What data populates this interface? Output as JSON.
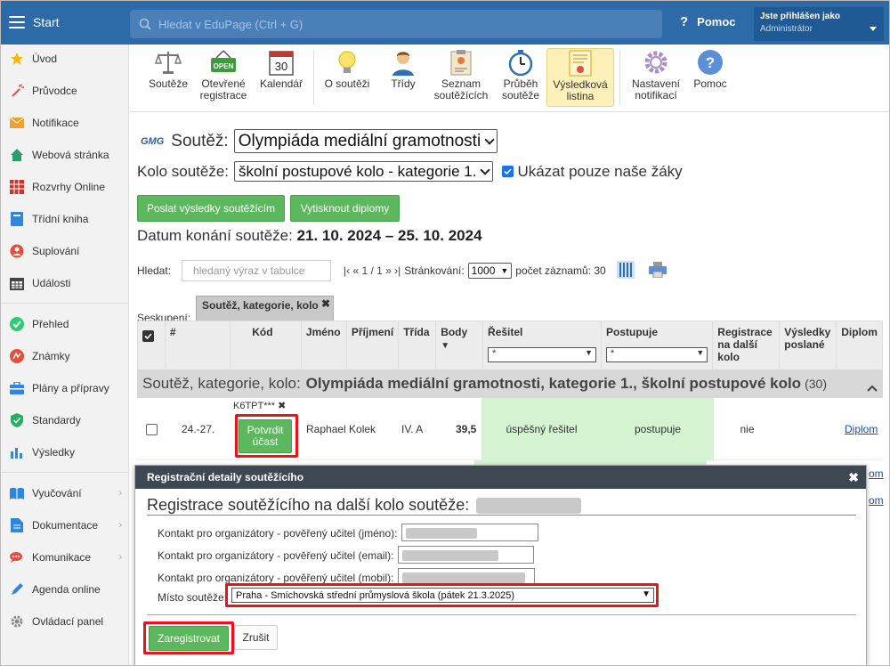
{
  "topbar": {
    "start_label": "Start",
    "search_placeholder": "Hledat v EduPage (Ctrl + G)",
    "help_label": "Pomoc",
    "user_line1": "Jste přihlášen jako",
    "user_line2": "Administrátor"
  },
  "sidebar": {
    "items": [
      {
        "label": "Úvod",
        "icon": "star-icon"
      },
      {
        "label": "Průvodce",
        "icon": "wand-icon"
      },
      {
        "label": "Notifikace",
        "icon": "envelope-icon"
      },
      {
        "label": "Webová stránka",
        "icon": "house-icon"
      },
      {
        "label": "Rozvrhy Online",
        "icon": "grid-icon"
      },
      {
        "label": "Třídní kniha",
        "icon": "book-icon"
      },
      {
        "label": "Suplování",
        "icon": "person-icon"
      },
      {
        "label": "Události",
        "icon": "calendar-icon"
      },
      {
        "label": "Přehled",
        "icon": "check-circle-icon"
      },
      {
        "label": "Známky",
        "icon": "grade-icon"
      },
      {
        "label": "Plány a přípravy",
        "icon": "briefcase-icon"
      },
      {
        "label": "Standardy",
        "icon": "shield-icon"
      },
      {
        "label": "Výsledky",
        "icon": "bar-chart-icon"
      },
      {
        "label": "Vyučování",
        "icon": "open-book-icon"
      },
      {
        "label": "Dokumentace",
        "icon": "document-icon"
      },
      {
        "label": "Komunikace",
        "icon": "chat-icon"
      },
      {
        "label": "Agenda online",
        "icon": "pen-icon"
      },
      {
        "label": "Ovládací panel",
        "icon": "gear-icon"
      }
    ]
  },
  "toolbar": {
    "items": [
      {
        "label": "Soutěže",
        "icon": "scales-icon"
      },
      {
        "label": "Otevřené registrace",
        "icon": "open-sign-icon",
        "badge": "OPEN"
      },
      {
        "label": "Kalendář",
        "icon": "calendar-icon",
        "day": "30"
      },
      {
        "label": "O soutěži",
        "icon": "lightbulb-icon"
      },
      {
        "label": "Třídy",
        "icon": "person-icon"
      },
      {
        "label": "Seznam soutěžících",
        "icon": "clipboard-icon"
      },
      {
        "label": "Průběh soutěže",
        "icon": "stopwatch-icon"
      },
      {
        "label": "Výsledková listina",
        "icon": "certificate-icon"
      },
      {
        "label": "Nastavení notifikací",
        "icon": "gear-icon"
      },
      {
        "label": "Pomoc",
        "icon": "help-icon"
      }
    ]
  },
  "main": {
    "logo_text": "GMG",
    "contest_label": "Soutěž:",
    "contest_value": "Olympiáda mediální gramotnosti",
    "round_label": "Kolo soutěže:",
    "round_value": "školní postupové kolo - kategorie 1.",
    "only_ours_label": "Ukázat pouze naše žáky",
    "send_results_btn": "Poslat výsledky soutěžícím",
    "print_diplomas_btn": "Vytisknout diplomy",
    "date_label": "Datum konání soutěže:",
    "date_value": "21. 10. 2024 – 25. 10. 2024",
    "search_label": "Hledat:",
    "search_placeholder": "hledaný výraz v tabulce",
    "pager": "|‹ « 1 / 1 » ›|",
    "paging_label": "Stránkování:",
    "paging_value": "1000",
    "count_label": "počet záznamů: 30",
    "group_label": "Seskupení:",
    "group_value": "Soutěž, kategorie, kolo"
  },
  "table": {
    "headers": [
      "#",
      "Kód",
      "Jméno",
      "Příjmení",
      "Třída",
      "Body",
      "Řešitel",
      "Postupuje",
      "Registrace na další kolo",
      "Výsledky poslané",
      "Diplom"
    ],
    "filter_value": "*",
    "group_prefix": "Soutěž, kategorie, kolo:",
    "group_name": "Olympiáda mediální gramotnosti, kategorie 1., školní postupové kolo",
    "group_count": "(30)",
    "row": {
      "rank": "24.-27.",
      "code": "K6TPT***",
      "confirm_btn": "Potvrdit účast",
      "name": "Raphael Kolek",
      "class": "IV. A",
      "points": "39,5",
      "solver": "úspěšný řešitel",
      "advances": "postupuje",
      "registration": "nie",
      "diploma": "Diplom"
    },
    "extra_diploma_1": "om",
    "extra_diploma_2": "om"
  },
  "dialog": {
    "header": "Registrační detaily soutěžícího",
    "title": "Registrace soutěžícího na další kolo soutěže:",
    "field_name_label": "Kontakt pro organizátory - pověřený učitel (jméno):",
    "field_email_label": "Kontakt pro organizátory - pověřený učitel (email):",
    "field_mobile_label": "Kontakt pro organizátory - pověřený učitel (mobil):",
    "place_label": "Místo soutěže:",
    "place_value": "Praha - Smíchovská střední průmyslová škola (pátek 21.3.2025)",
    "register_btn": "Zaregistrovat",
    "cancel_btn": "Zrušit"
  },
  "colors": {
    "topbar": "#2c6aa8",
    "green_button": "#5cb85c",
    "highlight_red": "#e8141a",
    "dialog_header": "#3d4852"
  }
}
